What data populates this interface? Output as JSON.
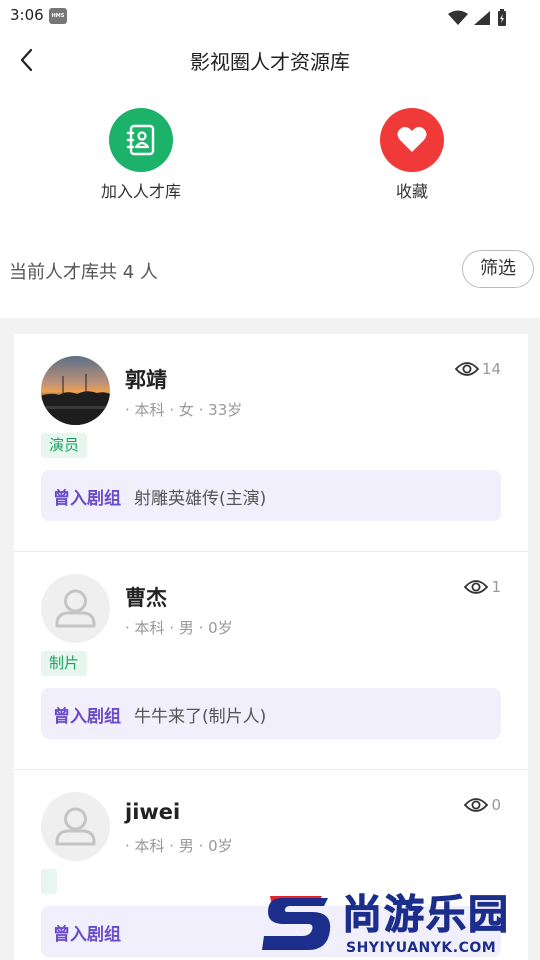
{
  "status_bar": {
    "time": "3:06",
    "hms_badge": "HMS"
  },
  "header": {
    "title": "影视圈人才资源库"
  },
  "actions": [
    {
      "label": "加入人才库",
      "icon": "contact-book-icon",
      "color": "#1db26a"
    },
    {
      "label": "收藏",
      "icon": "heart-icon",
      "color": "#f03a3a"
    }
  ],
  "summary": {
    "text": "当前人才库共 4 人",
    "filter_label": "筛选"
  },
  "talents": [
    {
      "name": "郭靖",
      "meta": "· 本科 · 女 · 33岁",
      "views": "14",
      "role": "演员",
      "crew_label": "曾入剧组",
      "crew_value": "射雕英雄传(主演)"
    },
    {
      "name": "曹杰",
      "meta": "· 本科 · 男 · 0岁",
      "views": "1",
      "role": "制片",
      "crew_label": "曾入剧组",
      "crew_value": "牛牛来了(制片人)"
    },
    {
      "name": "jiwei",
      "meta": "· 本科 · 男 · 0岁",
      "views": "0",
      "role": "",
      "crew_label": "曾入剧组",
      "crew_value": ""
    }
  ],
  "watermark": {
    "title": "尚游乐园",
    "url": "SHYIYUANYK.COM"
  },
  "colors": {
    "accent_green": "#1db26a",
    "accent_red": "#f03a3a",
    "crew_purple": "#6a4bc8",
    "watermark_blue": "#1c2e8c"
  }
}
